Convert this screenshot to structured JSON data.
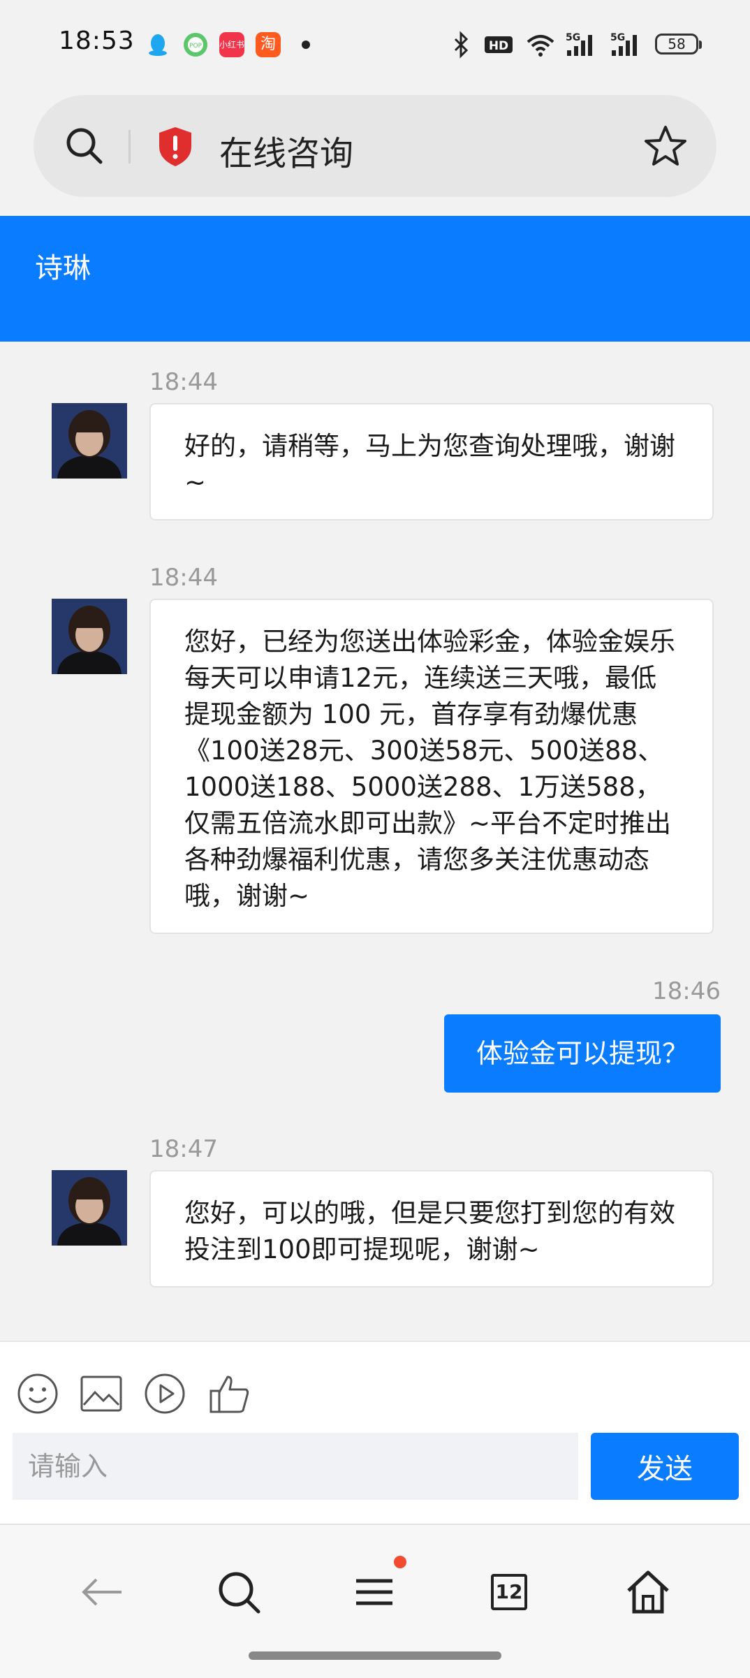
{
  "status_bar": {
    "time": "18:53",
    "notification_icons": [
      "qq-icon",
      "pop-app-icon",
      "xiaohongshu-icon",
      "taobao-icon"
    ],
    "xiaohongshu_label": "小红书",
    "taobao_label": "淘",
    "hd_label": "HD",
    "network_label": "5G",
    "battery": "58"
  },
  "address_bar": {
    "title": "在线咨询",
    "security_color": "#e02e2e"
  },
  "header": {
    "agent_name": "诗琳",
    "color": "#0a7cff"
  },
  "messages": [
    {
      "from": "agent",
      "time": "18:44",
      "text": "好的，请稍等，马上为您查询处理哦，谢谢~"
    },
    {
      "from": "agent",
      "time": "18:44",
      "text": "您好，已经为您送出体验彩金，体验金娱乐每天可以申请12元，连续送三天哦，最低提现金额为 100 元，首存享有劲爆优惠《100送28元、300送58元、500送88、1000送188、5000送288、1万送588，仅需五倍流水即可出款》~平台不定时推出各种劲爆福利优惠，请您多关注优惠动态哦，谢谢~"
    },
    {
      "from": "user",
      "time": "18:46",
      "text": "体验金可以提现？"
    },
    {
      "from": "agent",
      "time": "18:47",
      "text": "您好，可以的哦，但是只要您打到您的有效投注到100即可提现呢，谢谢~"
    }
  ],
  "composer": {
    "placeholder": "请输入",
    "value": "",
    "send_label": "发送",
    "tools": [
      "emoji-icon",
      "image-icon",
      "video-icon",
      "thumbs-up-icon"
    ]
  },
  "bottom_nav": {
    "tabs_count": "12",
    "items": [
      "back-arrow-icon",
      "search-icon",
      "menu-icon",
      "tabs-icon",
      "home-icon"
    ],
    "menu_badge": true
  }
}
